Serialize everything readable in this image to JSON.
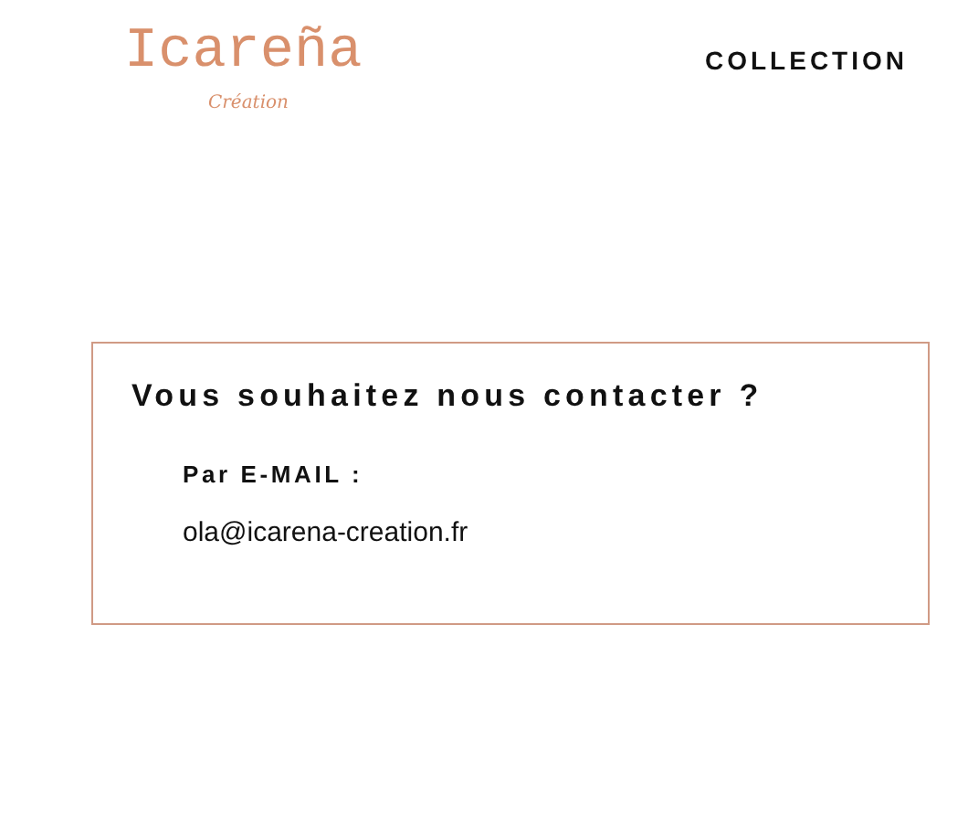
{
  "header": {
    "logo": {
      "name": "Icareña",
      "tagline": "Création"
    },
    "nav": [
      {
        "label": "COLLECTION"
      }
    ]
  },
  "contact": {
    "title": "Vous souhaitez nous contacter ?",
    "label": "Par E-MAIL :",
    "email": "ola@icarena-creation.fr"
  }
}
